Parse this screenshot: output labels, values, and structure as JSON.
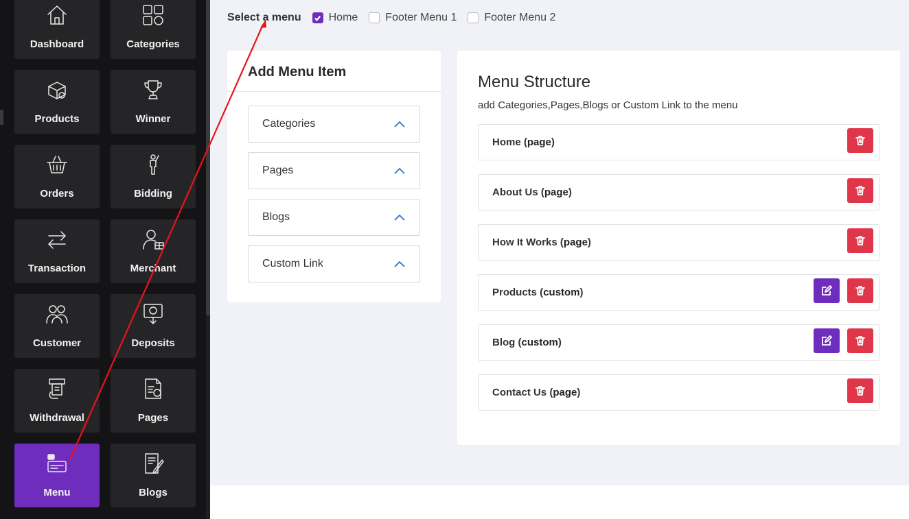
{
  "sidebar": {
    "items": [
      {
        "label": "Dashboard",
        "icon": "home-icon"
      },
      {
        "label": "Categories",
        "icon": "grid-icon"
      },
      {
        "label": "Products",
        "icon": "box-icon"
      },
      {
        "label": "Winner",
        "icon": "trophy-icon"
      },
      {
        "label": "Orders",
        "icon": "basket-icon"
      },
      {
        "label": "Bidding",
        "icon": "raised-hand-icon"
      },
      {
        "label": "Transaction",
        "icon": "arrows-icon"
      },
      {
        "label": "Merchant",
        "icon": "merchant-icon"
      },
      {
        "label": "Customer",
        "icon": "users-icon"
      },
      {
        "label": "Deposits",
        "icon": "deposit-icon"
      },
      {
        "label": "Withdrawal",
        "icon": "atm-icon"
      },
      {
        "label": "Pages",
        "icon": "document-icon"
      },
      {
        "label": "Menu",
        "icon": "menu-card-icon",
        "active": true
      },
      {
        "label": "Blogs",
        "icon": "blog-icon"
      }
    ],
    "active_color": "#6f2dbd"
  },
  "menu_select": {
    "label": "Select a menu",
    "options": [
      {
        "label": "Home",
        "checked": true
      },
      {
        "label": "Footer Menu 1",
        "checked": false
      },
      {
        "label": "Footer Menu 2",
        "checked": false
      }
    ]
  },
  "add_menu_item": {
    "title": "Add Menu Item",
    "sections": [
      "Categories",
      "Pages",
      "Blogs",
      "Custom Link"
    ]
  },
  "menu_structure": {
    "title": "Menu Structure",
    "subtitle": "add Categories,Pages,Blogs or Custom Link to the menu",
    "items": [
      {
        "name": "Home",
        "type": "page",
        "editable": false
      },
      {
        "name": "About Us",
        "type": "page",
        "editable": false
      },
      {
        "name": "How It Works",
        "type": "page",
        "editable": false
      },
      {
        "name": "Products",
        "type": "custom",
        "editable": true
      },
      {
        "name": "Blog",
        "type": "custom",
        "editable": true
      },
      {
        "name": "Contact Us",
        "type": "page",
        "editable": false
      }
    ]
  },
  "colors": {
    "accent": "#6f2dbd",
    "danger": "#e0364a",
    "annotation_arrow": "#e8141c"
  }
}
